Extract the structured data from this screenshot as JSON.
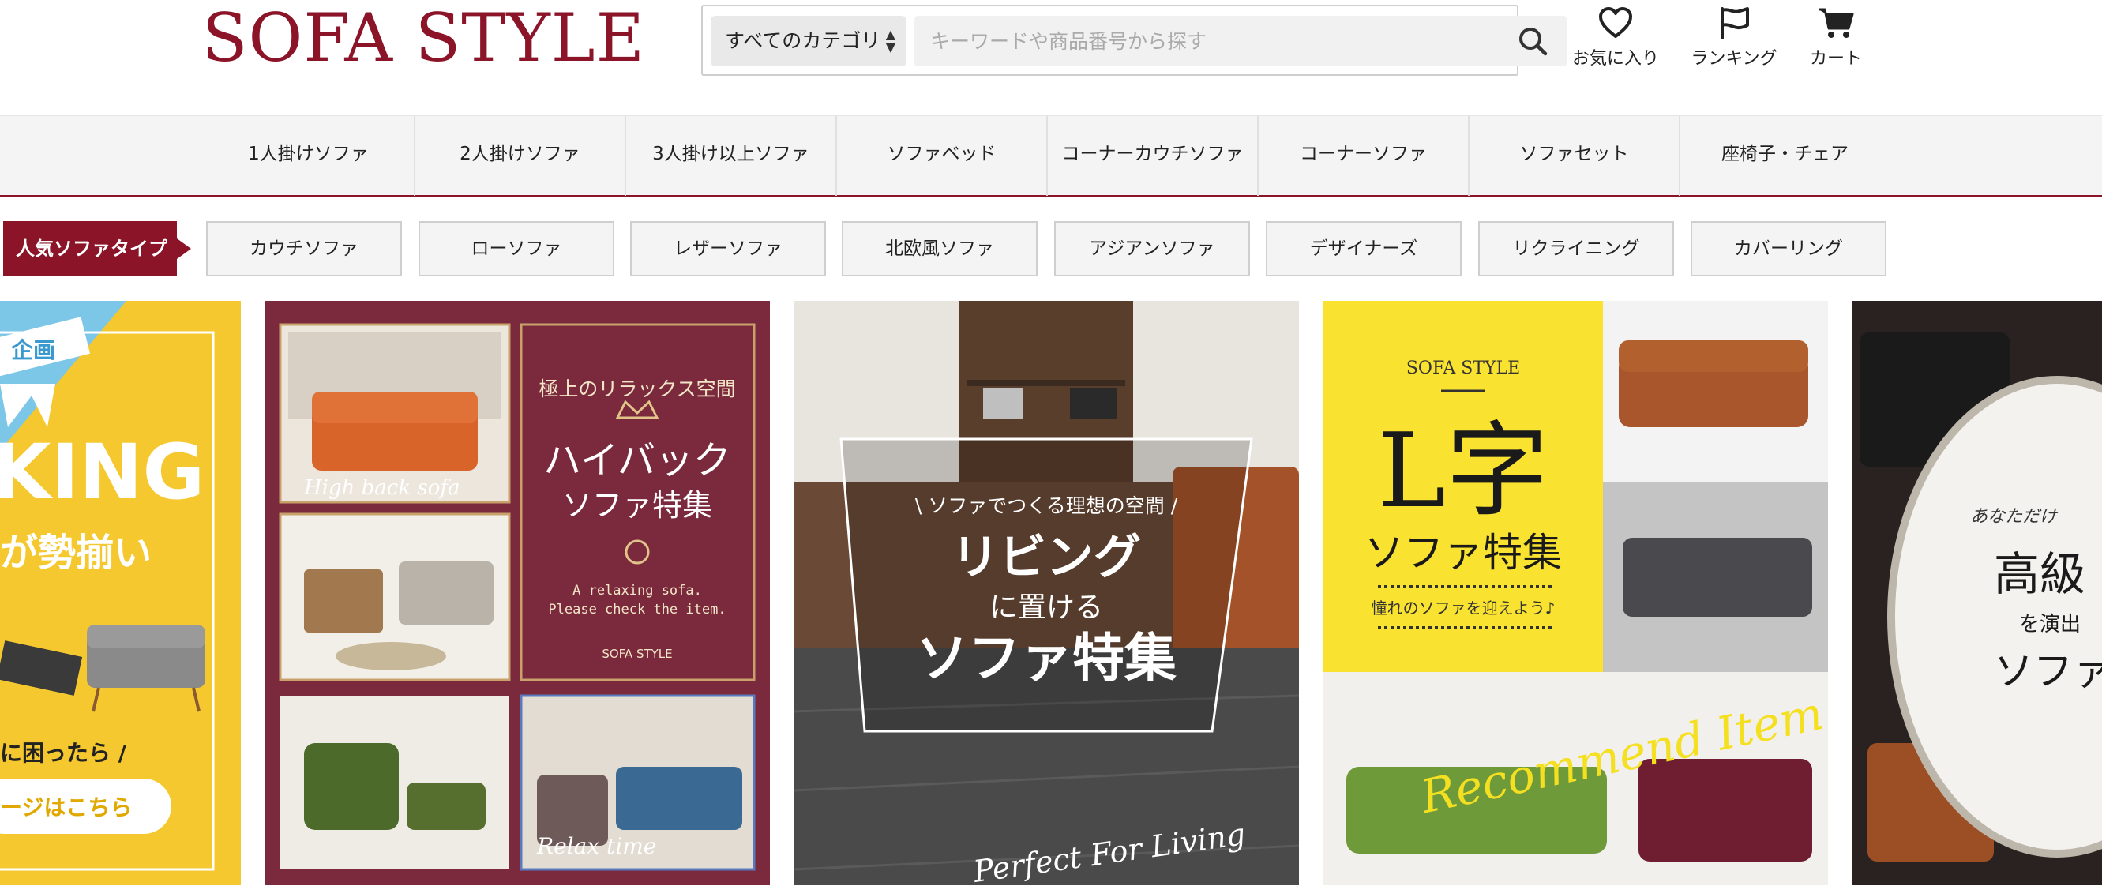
{
  "header": {
    "logo": "SOFA STYLE",
    "search": {
      "category": "すべてのカテゴリ",
      "placeholder": "キーワードや商品番号から探す"
    },
    "icons": [
      {
        "label": "お気に入り",
        "icon": "heart-icon"
      },
      {
        "label": "ランキング",
        "icon": "flag-icon"
      },
      {
        "label": "カート",
        "icon": "cart-icon"
      }
    ]
  },
  "category_nav": [
    "1人掛けソファ",
    "2人掛けソファ",
    "3人掛け以上ソファ",
    "ソファベッド",
    "コーナーカウチソファ",
    "コーナーソファ",
    "ソファセット",
    "座椅子・チェア"
  ],
  "popular": {
    "label": "人気ソファタイプ",
    "types": [
      "カウチソファ",
      "ローソファ",
      "レザーソファ",
      "北欧風ソファ",
      "アジアンソファ",
      "デザイナーズ",
      "リクライニング",
      "カバーリング"
    ]
  },
  "banners": {
    "b1": {
      "top": "企画",
      "main": "KING",
      "sub": "が勢揃い",
      "line": "に困ったら /",
      "button": "ージはこちら"
    },
    "b2": {
      "script1": "High back sofa",
      "kicker": "極上のリラックス空間",
      "title1": "ハイバック",
      "title2": "ソファ特集",
      "en1": "A relaxing sofa.",
      "en2": "Please check the item.",
      "brand": "SOFA STYLE",
      "script2": "Relax time"
    },
    "b3": {
      "kicker": "\\ ソファでつくる理想の空間 /",
      "title1": "リビング",
      "title2": "に置ける",
      "title3": "ソファ特集",
      "script": "Perfect For Living"
    },
    "b4": {
      "brand": "SOFA STYLE",
      "title1": "L字",
      "title2": "ソファ特集",
      "sub": "憧れのソファを迎えよう♪",
      "script": "Recommend Item"
    },
    "b5": {
      "t1": "あなただけ",
      "t2": "高級",
      "t3": "を演出",
      "t4": "ソファ"
    }
  }
}
